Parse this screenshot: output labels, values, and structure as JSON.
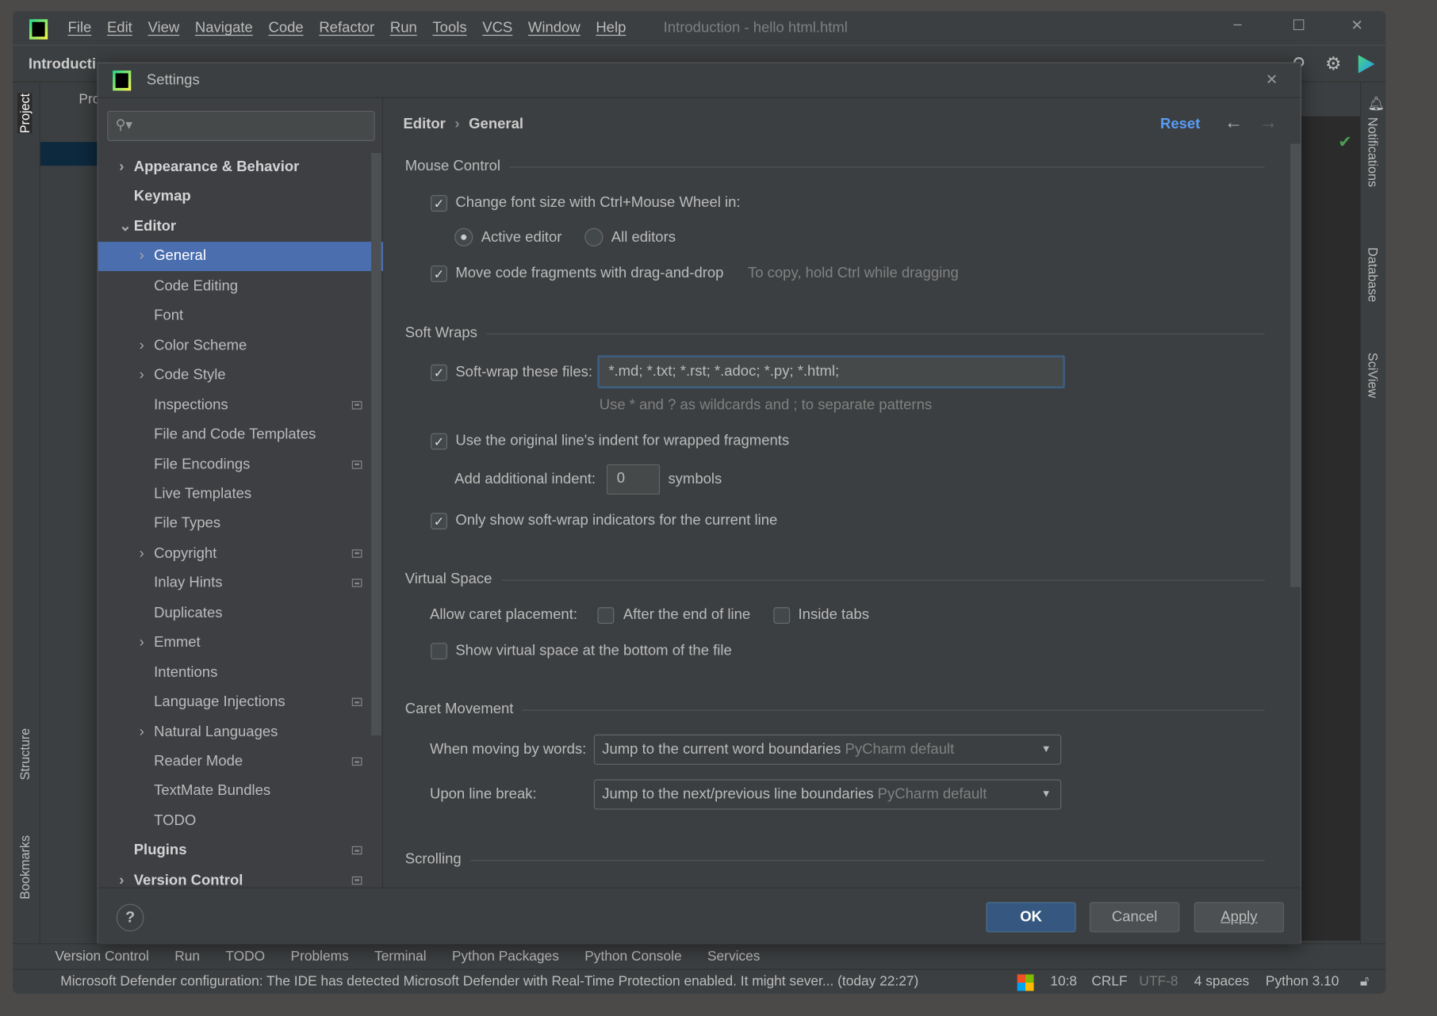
{
  "window": {
    "menu": [
      "File",
      "Edit",
      "View",
      "Navigate",
      "Code",
      "Refactor",
      "Run",
      "Tools",
      "VCS",
      "Window",
      "Help"
    ],
    "title": "Introduction - hello html.html",
    "project_crumb": "Introducti"
  },
  "left_stripe": {
    "project": "Project",
    "structure": "Structure",
    "bookmarks": "Bookmarks"
  },
  "project_panel": {
    "item": "Pro"
  },
  "right_stripe": {
    "notifications": "Notifications",
    "database": "Database",
    "sciview": "SciView"
  },
  "dialog": {
    "title": "Settings",
    "search_placeholder": "",
    "tree": [
      {
        "label": "Appearance & Behavior",
        "level": 0,
        "chevron": "right",
        "bold": true
      },
      {
        "label": "Keymap",
        "level": 0,
        "bold": true
      },
      {
        "label": "Editor",
        "level": 0,
        "chevron": "down",
        "bold": true
      },
      {
        "label": "General",
        "level": 1,
        "chevron": "right",
        "selected": true
      },
      {
        "label": "Code Editing",
        "level": 1
      },
      {
        "label": "Font",
        "level": 1
      },
      {
        "label": "Color Scheme",
        "level": 1,
        "chevron": "right"
      },
      {
        "label": "Code Style",
        "level": 1,
        "chevron": "right"
      },
      {
        "label": "Inspections",
        "level": 1,
        "badge": true
      },
      {
        "label": "File and Code Templates",
        "level": 1
      },
      {
        "label": "File Encodings",
        "level": 1,
        "badge": true
      },
      {
        "label": "Live Templates",
        "level": 1
      },
      {
        "label": "File Types",
        "level": 1
      },
      {
        "label": "Copyright",
        "level": 1,
        "chevron": "right",
        "badge": true
      },
      {
        "label": "Inlay Hints",
        "level": 1,
        "badge": true
      },
      {
        "label": "Duplicates",
        "level": 1
      },
      {
        "label": "Emmet",
        "level": 1,
        "chevron": "right"
      },
      {
        "label": "Intentions",
        "level": 1
      },
      {
        "label": "Language Injections",
        "level": 1,
        "badge": true
      },
      {
        "label": "Natural Languages",
        "level": 1,
        "chevron": "right"
      },
      {
        "label": "Reader Mode",
        "level": 1,
        "badge": true
      },
      {
        "label": "TextMate Bundles",
        "level": 1
      },
      {
        "label": "TODO",
        "level": 1
      },
      {
        "label": "Plugins",
        "level": 0,
        "bold": true,
        "badge": true
      },
      {
        "label": "Version Control",
        "level": 0,
        "chevron": "right",
        "bold": true,
        "badge": true
      }
    ],
    "breadcrumb": [
      "Editor",
      "General"
    ],
    "reset": "Reset",
    "mouse": {
      "title": "Mouse Control",
      "font_size": "Change font size with Ctrl+Mouse Wheel in:",
      "font_size_checked": true,
      "active_editor": "Active editor",
      "all_editors": "All editors",
      "selected": "Active editor",
      "dnd": "Move code fragments with drag-and-drop",
      "dnd_checked": true,
      "dnd_hint": "To copy, hold Ctrl while dragging"
    },
    "softwraps": {
      "title": "Soft Wraps",
      "files_label": "Soft-wrap these files:",
      "files_checked": true,
      "files_value": "*.md; *.txt; *.rst; *.adoc; *.py; *.html;",
      "files_hint": "Use * and ? as wildcards and ; to separate patterns",
      "indent": "Use the original line's indent for wrapped fragments",
      "indent_checked": true,
      "add_indent_label": "Add additional indent:",
      "add_indent_value": "0",
      "symbols": "symbols",
      "only_current": "Only show soft-wrap indicators for the current line",
      "only_current_checked": true
    },
    "virtual": {
      "title": "Virtual Space",
      "caret_label": "Allow caret placement:",
      "after_end": "After the end of line",
      "inside_tabs": "Inside tabs",
      "show_bottom": "Show virtual space at the bottom of the file"
    },
    "caret": {
      "title": "Caret Movement",
      "words_label": "When moving by words:",
      "words_value": "Jump to the current word boundaries",
      "words_hint": "PyCharm default",
      "break_label": "Upon line break:",
      "break_value": "Jump to the next/previous line boundaries",
      "break_hint": "PyCharm default"
    },
    "scrolling": {
      "title": "Scrolling"
    },
    "buttons": {
      "help": "?",
      "ok": "OK",
      "cancel": "Cancel",
      "apply": "Apply"
    }
  },
  "toolwindows": [
    "Version Control",
    "Run",
    "TODO",
    "Problems",
    "Terminal",
    "Python Packages",
    "Python Console",
    "Services"
  ],
  "status": {
    "message": "Microsoft Defender configuration: The IDE has detected Microsoft Defender with Real-Time Protection enabled. It might sever... (today 22:27)",
    "position": "10:8",
    "line_sep": "CRLF",
    "encoding": "UTF-8",
    "indent": "4 spaces",
    "interpreter": "Python 3.10"
  },
  "colors": {
    "accent": "#4b6eaf",
    "link": "#589df6",
    "ok": "#365880"
  }
}
